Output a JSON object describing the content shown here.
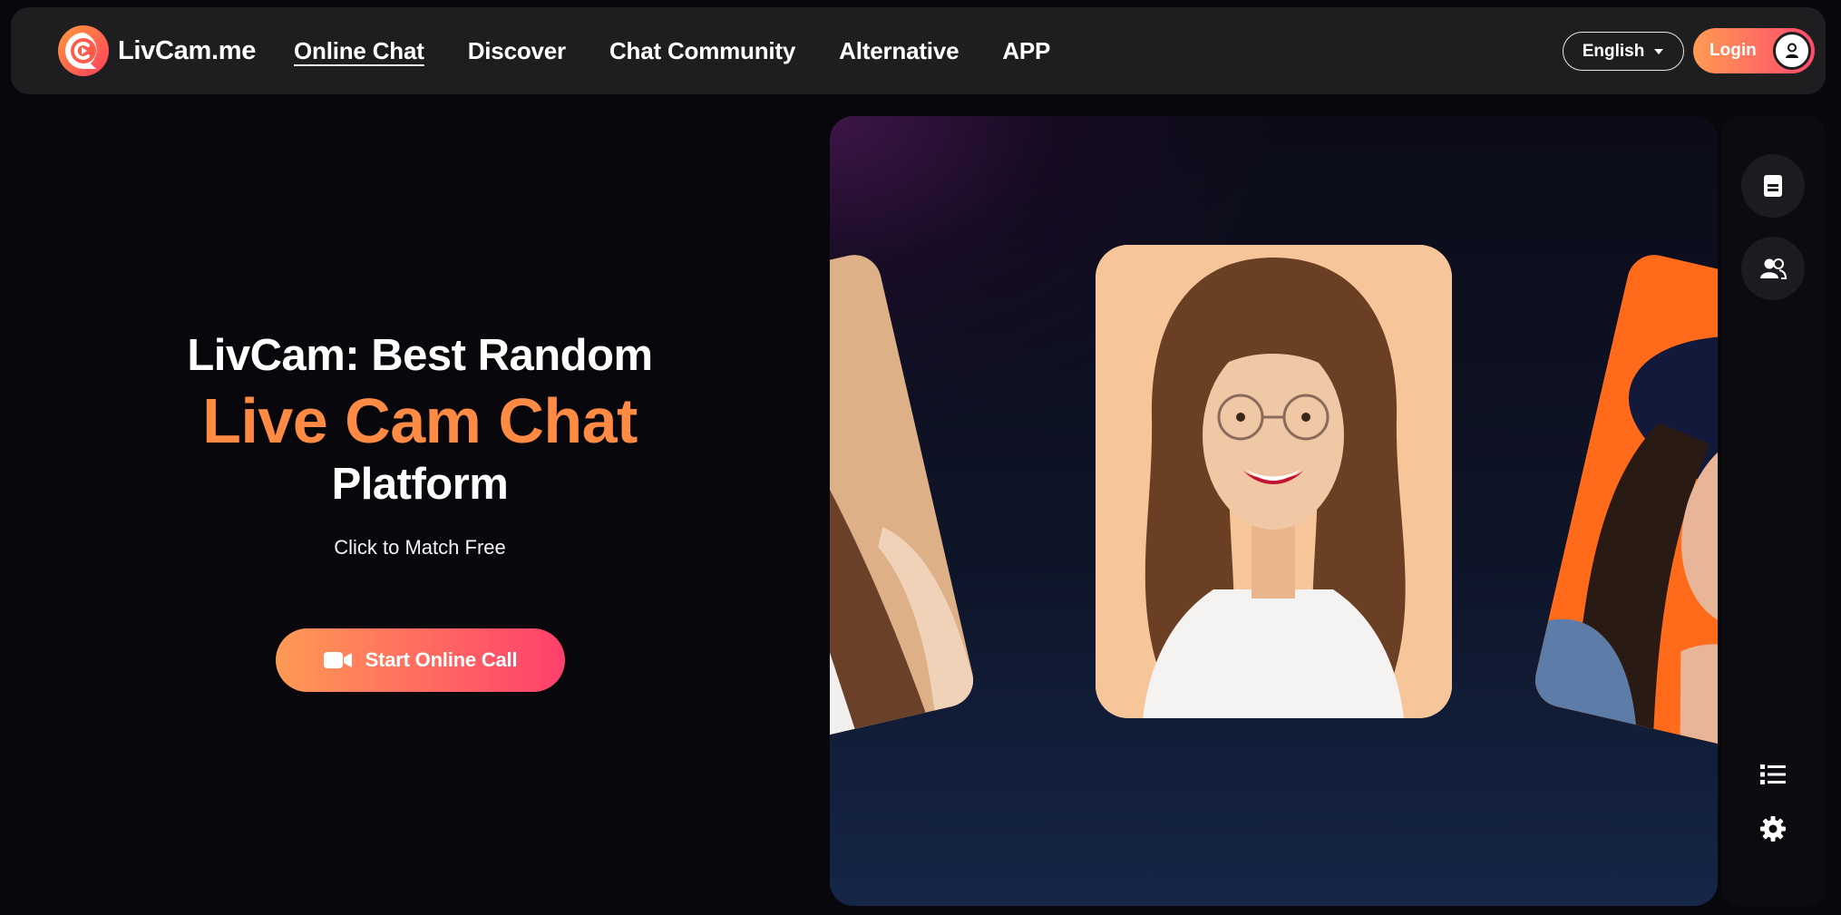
{
  "brand": {
    "name": "LivCam.me",
    "colors": {
      "accent_orange": "#ff8a44",
      "gradient_start": "#ff9a54",
      "gradient_end": "#ff4a6a",
      "nav_bg": "#1e1e21",
      "page_bg": "#07070c"
    }
  },
  "nav": {
    "links": [
      {
        "label": "Online Chat",
        "active": true
      },
      {
        "label": "Discover",
        "active": false
      },
      {
        "label": "Chat Community",
        "active": false
      },
      {
        "label": "Alternative",
        "active": false
      },
      {
        "label": "APP",
        "active": false
      }
    ],
    "language": {
      "selected": "English",
      "icon": "caret-down-icon"
    },
    "login": {
      "label": "Login",
      "icon": "user-icon"
    }
  },
  "hero": {
    "line1": "LivCam: Best Random",
    "line2": "Live Cam Chat",
    "line3": "Platform",
    "subtitle": "Click to Match Free",
    "cta": {
      "label": "Start Online Call",
      "icon": "video-camera-icon"
    }
  },
  "side_rail": {
    "buttons": [
      {
        "icon": "document-icon"
      },
      {
        "icon": "users-icon"
      }
    ],
    "icons": [
      {
        "icon": "list-icon"
      },
      {
        "icon": "gear-icon"
      }
    ]
  }
}
